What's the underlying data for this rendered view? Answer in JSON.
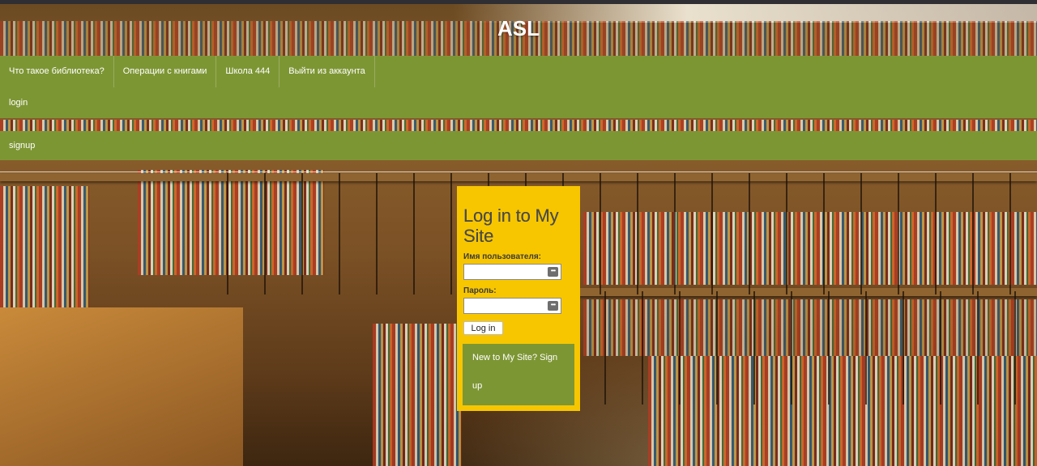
{
  "site": {
    "title": "ASL"
  },
  "nav": {
    "items": [
      {
        "label": "Что такое библиотека?"
      },
      {
        "label": "Операции с книгами"
      },
      {
        "label": "Школа 444"
      },
      {
        "label": "Выйти из аккаунта"
      }
    ],
    "login_label": "login",
    "signup_label": "signup"
  },
  "login_form": {
    "heading": "Log in to My Site",
    "username_label": "Имя пользователя:",
    "username_value": "",
    "password_label": "Пароль:",
    "password_value": "",
    "submit_label": "Log in",
    "signup_prompt_line1": "New to My Site? Sign",
    "signup_prompt_line2": "up"
  },
  "colors": {
    "nav_green": "#7d9634",
    "login_panel_yellow": "#f7c600"
  },
  "icons": {
    "field_icon": "password-manager-key-icon"
  }
}
